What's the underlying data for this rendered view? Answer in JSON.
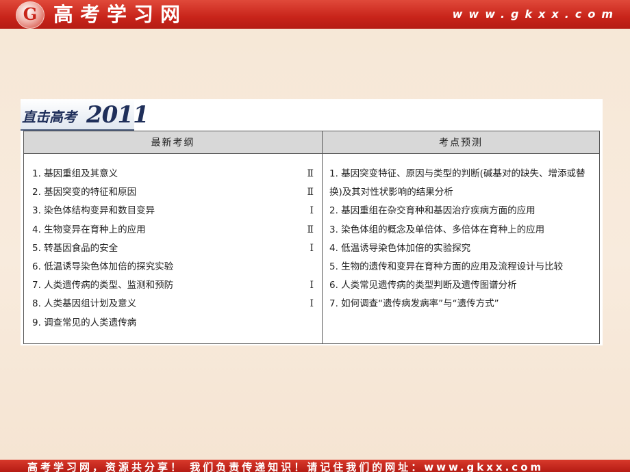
{
  "banner": {
    "logo_letter": "G",
    "site_name": "高考学习网",
    "site_url": "www.gkxx.com"
  },
  "section_header": {
    "title": "直击高考",
    "year": "2011"
  },
  "table": {
    "col_left_header": "最新考纲",
    "col_right_header": "考点预测",
    "left_items": [
      {
        "text": "1. 基因重组及其意义",
        "level": "Ⅱ"
      },
      {
        "text": "2. 基因突变的特征和原因",
        "level": "Ⅱ"
      },
      {
        "text": "3. 染色体结构变异和数目变异",
        "level": "Ⅰ"
      },
      {
        "text": "4. 生物变异在育种上的应用",
        "level": "Ⅱ"
      },
      {
        "text": "5. 转基因食品的安全",
        "level": "Ⅰ"
      },
      {
        "text": "6. 低温诱导染色体加倍的探究实验",
        "level": ""
      },
      {
        "text": "7. 人类遗传病的类型、监测和预防",
        "level": "Ⅰ"
      },
      {
        "text": "8. 人类基因组计划及意义",
        "level": "Ⅰ"
      },
      {
        "text": "9. 调查常见的人类遗传病",
        "level": ""
      }
    ],
    "right_items": [
      "1. 基因突变特征、原因与类型的判断(碱基对的缺失、增添或替换)及其对性状影响的结果分析",
      "2. 基因重组在杂交育种和基因治疗疾病方面的应用",
      "3. 染色体组的概念及单倍体、多倍体在育种上的应用",
      "4. 低温诱导染色体加倍的实验探究",
      "5. 生物的遗传和变异在育种方面的应用及流程设计与比较",
      "6. 人类常见遗传病的类型判断及遗传图谱分析",
      "7. 如何调查“遗传病发病率”与“遗传方式”"
    ]
  },
  "footer": {
    "text": "高考学习网，资源共分享！ 我们负责传递知识！请记住我们的网址：www.gkxx.com"
  }
}
